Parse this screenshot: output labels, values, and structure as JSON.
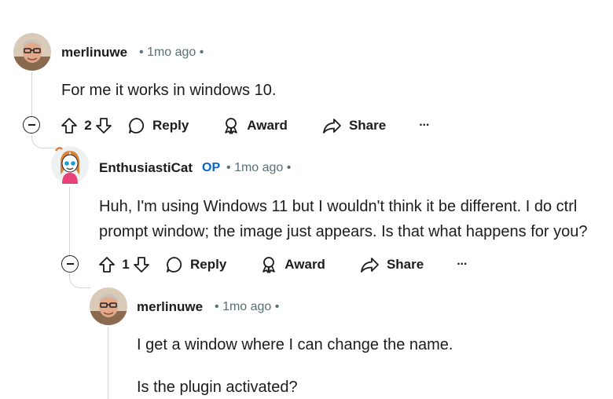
{
  "comments": [
    {
      "author": "merlinuwe",
      "sep1": "•",
      "time": "1mo ago",
      "sep2": "•",
      "lines": [
        "For me it works in windows 10."
      ],
      "votes": "2",
      "reply_label": "Reply",
      "award_label": "Award",
      "share_label": "Share",
      "more_label": "···"
    },
    {
      "author": "EnthusiastiCat",
      "op_label": "OP",
      "sep1": "•",
      "time": "1mo ago",
      "sep2": "•",
      "lines": [
        "Huh, I'm using Windows 11 but I wouldn't think it be different. I do ctrl",
        "prompt window; the image just appears. Is that what happens for you?"
      ],
      "votes": "1",
      "reply_label": "Reply",
      "award_label": "Award",
      "share_label": "Share",
      "more_label": "···"
    },
    {
      "author": "merlinuwe",
      "sep1": "•",
      "time": "1mo ago",
      "sep2": "•",
      "lines": [
        "I get a window where I can change the name.",
        "Is the plugin activated?"
      ]
    }
  ],
  "colors": {
    "meta": "#576f76",
    "op": "#0a66c2",
    "thread": "#d0d4d8",
    "text": "#1c1c1c"
  },
  "icons": [
    "upvote-icon",
    "downvote-icon",
    "comment-icon",
    "award-icon",
    "share-icon",
    "more-icon",
    "collapse-icon"
  ]
}
